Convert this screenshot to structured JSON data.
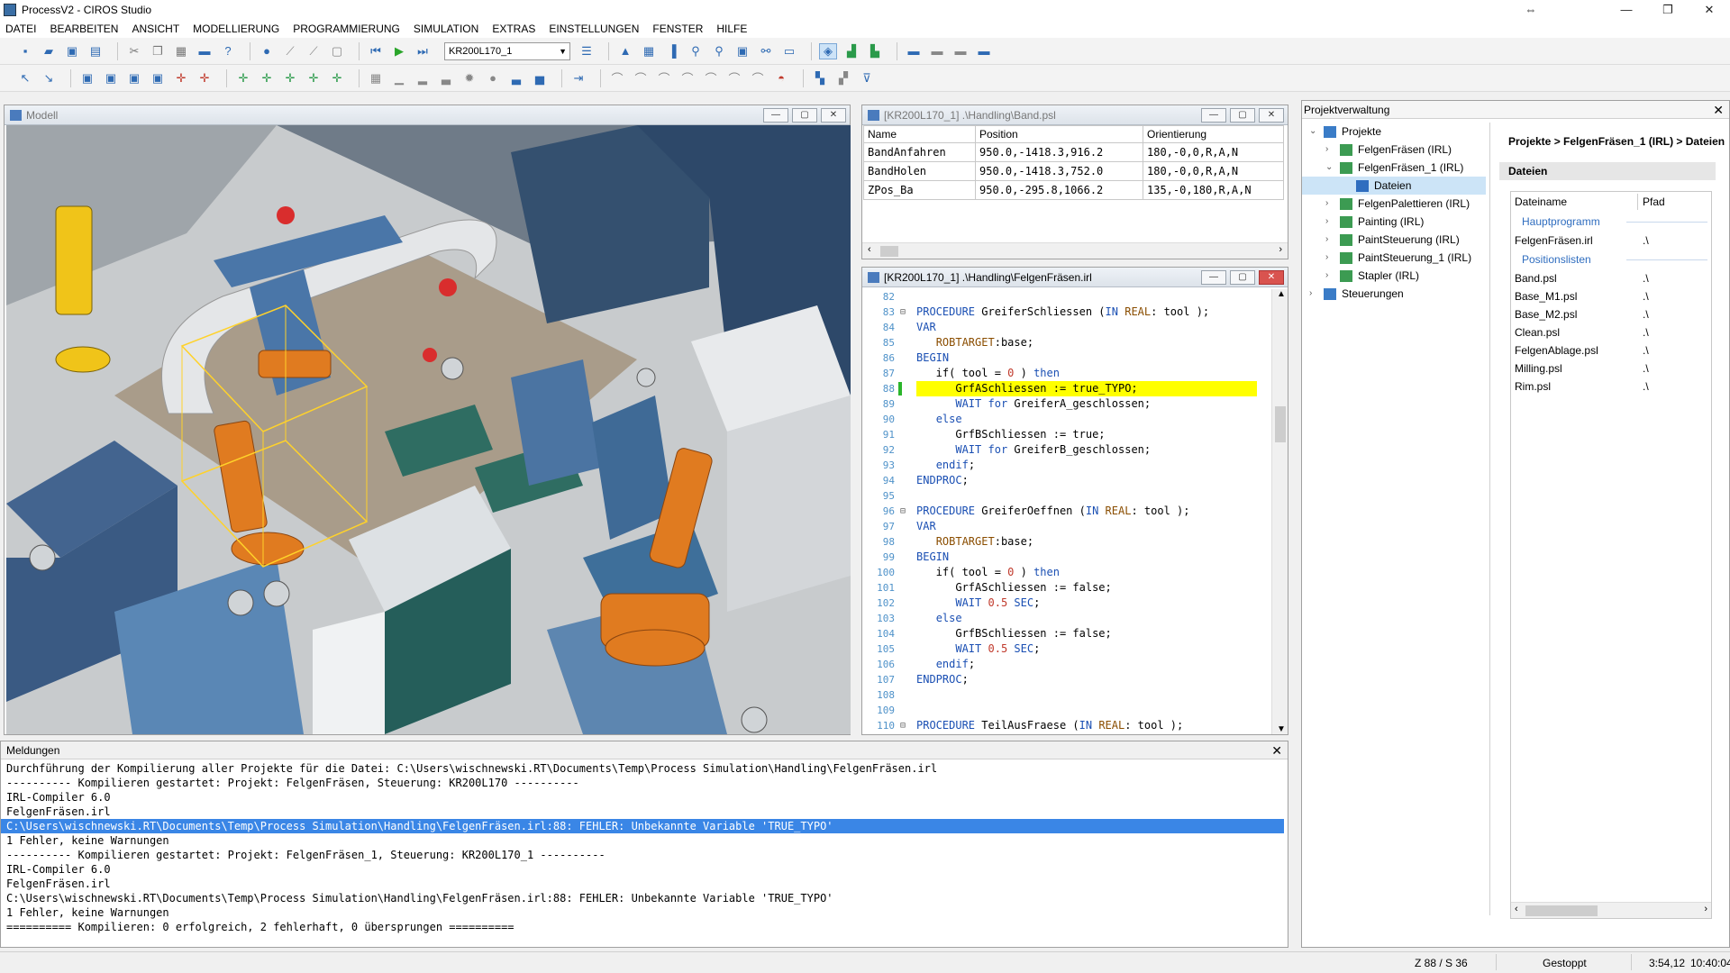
{
  "window": {
    "title": "ProcessV2 - CIROS Studio"
  },
  "menu": [
    "DATEI",
    "BEARBEITEN",
    "ANSICHT",
    "MODELLIERUNG",
    "PROGRAMMIERUNG",
    "SIMULATION",
    "EXTRAS",
    "EINSTELLUNGEN",
    "FENSTER",
    "HILFE"
  ],
  "toolbar": {
    "robot_selector": "KR200L170_1"
  },
  "model_view": {
    "title": "Modell"
  },
  "position_list": {
    "title": "[KR200L170_1] .\\Handling\\Band.psl",
    "columns": [
      "Name",
      "Position",
      "Orientierung"
    ],
    "rows": [
      [
        "BandAnfahren",
        "950.0,-1418.3,916.2",
        "180,-0,0,R,A,N"
      ],
      [
        "BandHolen",
        "950.0,-1418.3,752.0",
        "180,-0,0,R,A,N"
      ],
      [
        "ZPos_Ba",
        "950.0,-295.8,1066.2",
        "135,-0,180,R,A,N"
      ]
    ]
  },
  "code_editor": {
    "title": "[KR200L170_1] .\\Handling\\FelgenFräsen.irl",
    "lines": [
      {
        "n": "82",
        "fold": "",
        "t": ""
      },
      {
        "n": "83",
        "fold": "⊟",
        "t": "PROCEDURE GreiferSchliessen (IN REAL: tool );"
      },
      {
        "n": "84",
        "fold": "",
        "t": "VAR"
      },
      {
        "n": "85",
        "fold": "",
        "t": "   ROBTARGET:base;"
      },
      {
        "n": "86",
        "fold": "",
        "t": "BEGIN"
      },
      {
        "n": "87",
        "fold": "",
        "t": "   if( tool = 0 ) then"
      },
      {
        "n": "88",
        "fold": "",
        "t": "      GrfASchliessen := true_TYPO;",
        "hl": true
      },
      {
        "n": "89",
        "fold": "",
        "t": "      WAIT for GreiferA_geschlossen;"
      },
      {
        "n": "90",
        "fold": "",
        "t": "   else"
      },
      {
        "n": "91",
        "fold": "",
        "t": "      GrfBSchliessen := true;"
      },
      {
        "n": "92",
        "fold": "",
        "t": "      WAIT for GreiferB_geschlossen;"
      },
      {
        "n": "93",
        "fold": "",
        "t": "   endif;"
      },
      {
        "n": "94",
        "fold": "",
        "t": "ENDPROC;"
      },
      {
        "n": "95",
        "fold": "",
        "t": ""
      },
      {
        "n": "96",
        "fold": "⊟",
        "t": "PROCEDURE GreiferOeffnen (IN REAL: tool );"
      },
      {
        "n": "97",
        "fold": "",
        "t": "VAR"
      },
      {
        "n": "98",
        "fold": "",
        "t": "   ROBTARGET:base;"
      },
      {
        "n": "99",
        "fold": "",
        "t": "BEGIN"
      },
      {
        "n": "100",
        "fold": "",
        "t": "   if( tool = 0 ) then"
      },
      {
        "n": "101",
        "fold": "",
        "t": "      GrfASchliessen := false;"
      },
      {
        "n": "102",
        "fold": "",
        "t": "      WAIT 0.5 SEC;"
      },
      {
        "n": "103",
        "fold": "",
        "t": "   else"
      },
      {
        "n": "104",
        "fold": "",
        "t": "      GrfBSchliessen := false;"
      },
      {
        "n": "105",
        "fold": "",
        "t": "      WAIT 0.5 SEC;"
      },
      {
        "n": "106",
        "fold": "",
        "t": "   endif;"
      },
      {
        "n": "107",
        "fold": "",
        "t": "ENDPROC;"
      },
      {
        "n": "108",
        "fold": "",
        "t": ""
      },
      {
        "n": "109",
        "fold": "",
        "t": ""
      },
      {
        "n": "110",
        "fold": "⊟",
        "t": "PROCEDURE TeilAusFraese (IN REAL: tool );"
      }
    ]
  },
  "messages": {
    "title": "Meldungen",
    "lines": [
      "Durchführung der Kompilierung aller Projekte für die Datei: C:\\Users\\wischnewski.RT\\Documents\\Temp\\Process Simulation\\Handling\\FelgenFräsen.irl",
      "---------- Kompilieren gestartet: Projekt: FelgenFräsen, Steuerung: KR200L170 ----------",
      "IRL-Compiler 6.0",
      "FelgenFräsen.irl",
      "C:\\Users\\wischnewski.RT\\Documents\\Temp\\Process Simulation\\Handling\\FelgenFräsen.irl:88: FEHLER: Unbekannte Variable 'TRUE_TYPO'",
      "1 Fehler, keine Warnungen",
      "---------- Kompilieren gestartet: Projekt: FelgenFräsen_1, Steuerung: KR200L170_1 ----------",
      "IRL-Compiler 6.0",
      "FelgenFräsen.irl",
      "C:\\Users\\wischnewski.RT\\Documents\\Temp\\Process Simulation\\Handling\\FelgenFräsen.irl:88: FEHLER: Unbekannte Variable 'TRUE_TYPO'",
      "1 Fehler, keine Warnungen",
      "========== Kompilieren: 0 erfolgreich, 2 fehlerhaft, 0 übersprungen =========="
    ],
    "selected_index": 4
  },
  "project_panel": {
    "title": "Projektverwaltung",
    "tree": [
      {
        "label": "Projekte",
        "level": 0,
        "exp": "⌄",
        "icon": "folder"
      },
      {
        "label": "FelgenFräsen (IRL)",
        "level": 1,
        "exp": "›",
        "icon": "project"
      },
      {
        "label": "FelgenFräsen_1 (IRL)",
        "level": 1,
        "exp": "⌄",
        "icon": "project"
      },
      {
        "label": "Dateien",
        "level": 2,
        "exp": "",
        "icon": "files",
        "selected": true
      },
      {
        "label": "FelgenPalettieren (IRL)",
        "level": 1,
        "exp": "›",
        "icon": "project"
      },
      {
        "label": "Painting (IRL)",
        "level": 1,
        "exp": "›",
        "icon": "project"
      },
      {
        "label": "PaintSteuerung (IRL)",
        "level": 1,
        "exp": "›",
        "icon": "project"
      },
      {
        "label": "PaintSteuerung_1 (IRL)",
        "level": 1,
        "exp": "›",
        "icon": "project"
      },
      {
        "label": "Stapler (IRL)",
        "level": 1,
        "exp": "›",
        "icon": "project"
      },
      {
        "label": "Steuerungen",
        "level": 0,
        "exp": "›",
        "icon": "controller"
      }
    ],
    "breadcrumb": "Projekte > FelgenFräsen_1 (IRL) > Dateien",
    "section": "Dateien",
    "file_columns": [
      "Dateiname",
      "Pfad"
    ],
    "groups": [
      {
        "name": "Hauptprogramm",
        "files": [
          {
            "name": "FelgenFräsen.irl",
            "path": ".\\"
          }
        ]
      },
      {
        "name": "Positionslisten",
        "files": [
          {
            "name": "Band.psl",
            "path": ".\\"
          },
          {
            "name": "Base_M1.psl",
            "path": ".\\"
          },
          {
            "name": "Base_M2.psl",
            "path": ".\\"
          },
          {
            "name": "Clean.psl",
            "path": ".\\"
          },
          {
            "name": "FelgenAblage.psl",
            "path": ".\\"
          },
          {
            "name": "Milling.psl",
            "path": ".\\"
          },
          {
            "name": "Rim.psl",
            "path": ".\\"
          }
        ]
      }
    ]
  },
  "statusbar": {
    "cursor": "Z 88 / S 36",
    "state": "Gestoppt",
    "sim_time": "3:54,12",
    "clock": "10:40:04"
  }
}
